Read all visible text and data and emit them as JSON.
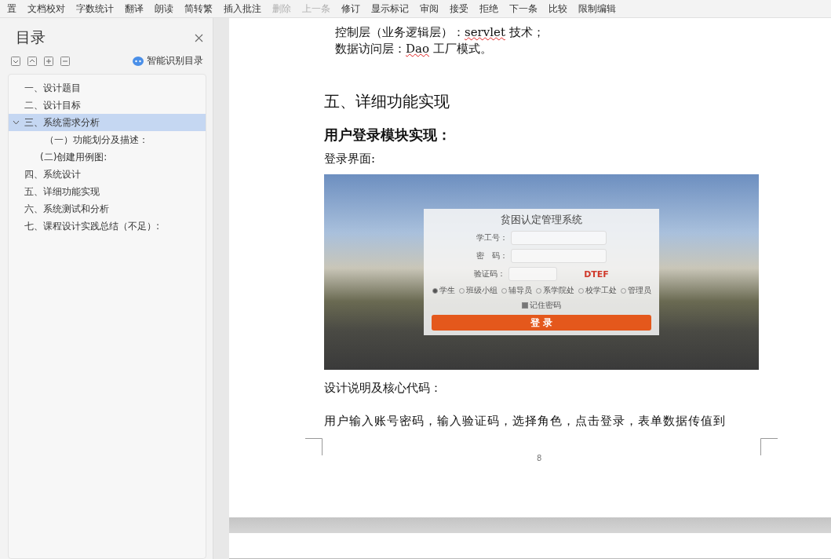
{
  "toolbar": {
    "items": [
      {
        "label": "置",
        "disabled": false
      },
      {
        "label": "文档校对",
        "disabled": false
      },
      {
        "label": "字数统计",
        "disabled": false
      },
      {
        "label": "翻译",
        "disabled": false
      },
      {
        "label": "朗读",
        "disabled": false
      },
      {
        "label": "简转繁",
        "disabled": false
      },
      {
        "label": "插入批注",
        "disabled": false
      },
      {
        "label": "删除",
        "disabled": true
      },
      {
        "label": "上一条",
        "disabled": true
      },
      {
        "label": "修订",
        "disabled": false
      },
      {
        "label": "显示标记",
        "disabled": false
      },
      {
        "label": "审阅",
        "disabled": false
      },
      {
        "label": "接受",
        "disabled": false
      },
      {
        "label": "拒绝",
        "disabled": false
      },
      {
        "label": "下一条",
        "disabled": false
      },
      {
        "label": "比较",
        "disabled": false
      },
      {
        "label": "限制编辑",
        "disabled": false
      }
    ]
  },
  "toc": {
    "title": "目录",
    "smart_button": "智能识别目录",
    "items": [
      {
        "label": "一、设计题目",
        "selected": false
      },
      {
        "label": "二、设计目标",
        "selected": false
      },
      {
        "label": "三、系统需求分析",
        "selected": true,
        "expanded": true,
        "children": [
          {
            "label": "（一）功能划分及描述：",
            "selected": false
          },
          {
            "label": "(二)创建用例图:",
            "selected": false
          }
        ]
      },
      {
        "label": "四、系统设计",
        "selected": false
      },
      {
        "label": "五、详细功能实现",
        "selected": false
      },
      {
        "label": "六、系统测试和分析",
        "selected": false
      },
      {
        "label": "七、课程设计实践总结（不足）:",
        "selected": false
      }
    ]
  },
  "document": {
    "top_lines": [
      [
        {
          "text": "控制层（业务逻辑层）：",
          "spell_error": false
        },
        {
          "text": "servlet",
          "spell_error": true
        },
        {
          "text": " 技术；",
          "spell_error": false
        }
      ],
      [
        {
          "text": "数据访问层：",
          "spell_error": false
        },
        {
          "text": "Dao",
          "spell_error": true
        },
        {
          "text": " 工厂模式。",
          "spell_error": false
        }
      ]
    ],
    "heading": "五、详细功能实现",
    "subheading": "用户登录模块实现：",
    "caption": "登录界面:",
    "login_screenshot": {
      "title": "贫困认定管理系统",
      "fields": [
        {
          "label": "学工号："
        },
        {
          "label": "密　码："
        }
      ],
      "captcha_label": "验证码：",
      "captcha": "DTEF",
      "roles": [
        {
          "label": "学生",
          "selected": true
        },
        {
          "label": "班级小组",
          "selected": false
        },
        {
          "label": "辅导员",
          "selected": false
        },
        {
          "label": "系学院处",
          "selected": false
        },
        {
          "label": "校学工处",
          "selected": false
        },
        {
          "label": "管理员",
          "selected": false
        }
      ],
      "remember": {
        "label": "记住密码",
        "checked": true
      },
      "button": "登 录"
    },
    "paragraphs": [
      "设计说明及核心代码：",
      "用户输入账号密码，输入验证码，选择角色，点击登录，表单数据传值到"
    ],
    "page_number": "8"
  }
}
